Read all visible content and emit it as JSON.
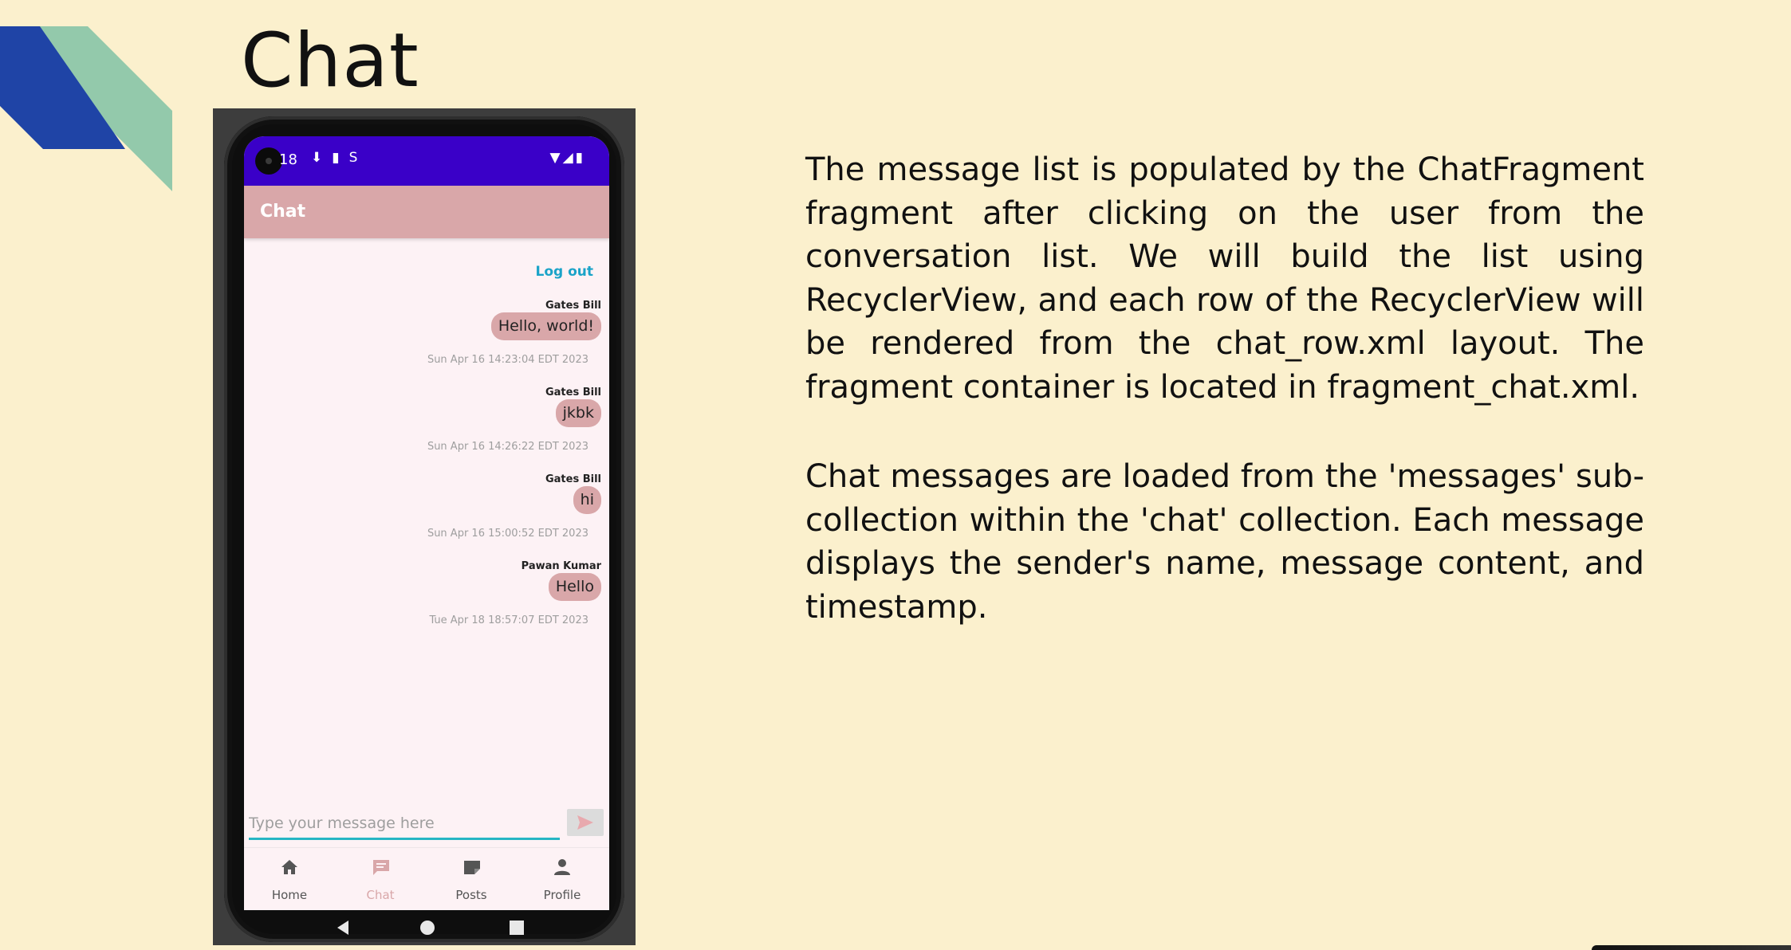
{
  "slide": {
    "title": "Chat",
    "paragraphs": [
      "The message list is populated by the ChatFragment fragment after clicking on the user from the conversation list. We will build the list using RecyclerView, and each row of the RecyclerView will be rendered from the chat_row.xml layout. The fragment container is located in fragment_chat.xml.",
      "Chat messages are loaded from the 'messages' sub-collection within the 'chat' collection. Each message displays the sender's name, message content, and timestamp."
    ],
    "colors": {
      "background": "#fbf0cd",
      "deco_blue": "#1f44a6",
      "deco_green": "#93c9ab"
    }
  },
  "phone": {
    "status_bar": {
      "time": "18",
      "icons": [
        "download-icon",
        "sd-card-icon",
        "sync-icon"
      ],
      "right_icons": [
        "wifi-icon",
        "signal-icon",
        "battery-icon"
      ]
    },
    "app_bar": {
      "title": "Chat"
    },
    "logout_label": "Log out",
    "messages": [
      {
        "sender": "Gates Bill",
        "text": "Hello, world!",
        "timestamp": "Sun Apr 16 14:23:04 EDT 2023"
      },
      {
        "sender": "Gates Bill",
        "text": "jkbk",
        "timestamp": "Sun Apr 16 14:26:22 EDT 2023"
      },
      {
        "sender": "Gates Bill",
        "text": "hi",
        "timestamp": "Sun Apr 16 15:00:52 EDT 2023"
      },
      {
        "sender": "Pawan Kumar",
        "text": "Hello",
        "timestamp": "Tue Apr 18 18:57:07 EDT 2023"
      }
    ],
    "composer": {
      "placeholder": "Type your message here",
      "value": ""
    },
    "bottom_nav": [
      {
        "label": "Home",
        "icon": "home-icon",
        "active": false
      },
      {
        "label": "Chat",
        "icon": "chat-icon",
        "active": true
      },
      {
        "label": "Posts",
        "icon": "posts-icon",
        "active": false
      },
      {
        "label": "Profile",
        "icon": "profile-icon",
        "active": false
      }
    ],
    "colors": {
      "status_bar": "#3a00c8",
      "app_bar": "#d9a7a9",
      "screen_bg": "#fdf2f5",
      "accent": "#1aa3c8",
      "input_underline": "#26b6c4"
    }
  }
}
